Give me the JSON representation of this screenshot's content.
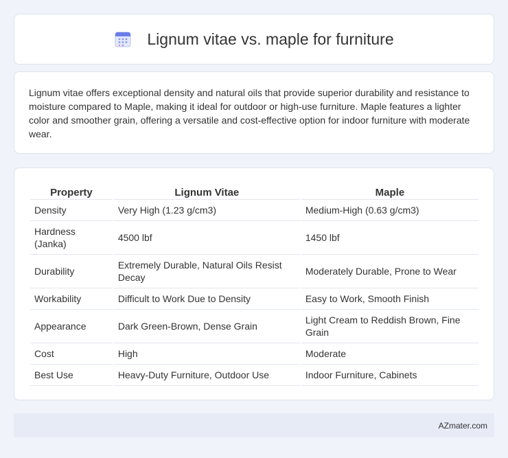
{
  "header": {
    "title": "Lignum vitae vs. maple for furniture",
    "icon": "calendar-icon"
  },
  "summary": {
    "text": "Lignum vitae offers exceptional density and natural oils that provide superior durability and resistance to moisture compared to Maple, making it ideal for outdoor or high-use furniture. Maple features a lighter color and smoother grain, offering a versatile and cost-effective option for indoor furniture with moderate wear."
  },
  "table": {
    "headers": [
      "Property",
      "Lignum Vitae",
      "Maple"
    ],
    "rows": [
      [
        "Density",
        "Very High (1.23 g/cm3)",
        "Medium-High (0.63 g/cm3)"
      ],
      [
        "Hardness (Janka)",
        "4500 lbf",
        "1450 lbf"
      ],
      [
        "Durability",
        "Extremely Durable, Natural Oils Resist Decay",
        "Moderately Durable, Prone to Wear"
      ],
      [
        "Workability",
        "Difficult to Work Due to Density",
        "Easy to Work, Smooth Finish"
      ],
      [
        "Appearance",
        "Dark Green-Brown, Dense Grain",
        "Light Cream to Reddish Brown, Fine Grain"
      ],
      [
        "Cost",
        "High",
        "Moderate"
      ],
      [
        "Best Use",
        "Heavy-Duty Furniture, Outdoor Use",
        "Indoor Furniture, Cabinets"
      ]
    ]
  },
  "footer": {
    "site": "AZmater.com"
  },
  "colors": {
    "background": "#f0f3fa",
    "card": "#ffffff",
    "footer": "#e6ebf5",
    "icon_top": "#6b7de8",
    "icon_body": "#e4e8fb"
  }
}
